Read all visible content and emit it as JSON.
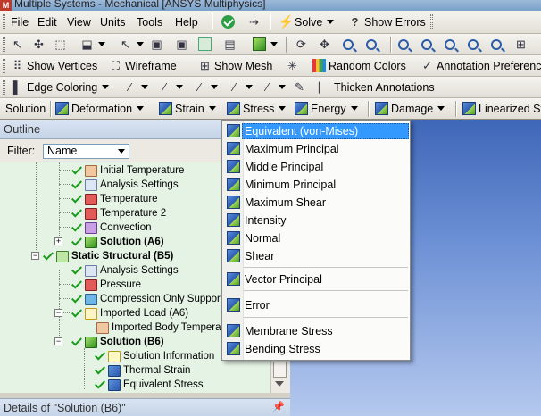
{
  "window": {
    "title": "Multiple Systems - Mechanical [ANSYS Multiphysics]",
    "app_icon_letter": "M"
  },
  "menubar": {
    "items": [
      "File",
      "Edit",
      "View",
      "Units",
      "Tools",
      "Help"
    ],
    "solve_label": "Solve",
    "show_errors_label": "Show Errors"
  },
  "toolbar3": {
    "show_vertices": "Show Vertices",
    "wireframe": "Wireframe",
    "show_mesh": "Show Mesh",
    "random_colors": "Random Colors",
    "annotation_prefs": "Annotation Preferences"
  },
  "toolbar4": {
    "edge_coloring": "Edge Coloring",
    "thicken_annotations": "Thicken Annotations"
  },
  "context_toolbar": {
    "solution": "Solution",
    "deformation": "Deformation",
    "strain": "Strain",
    "stress": "Stress",
    "energy": "Energy",
    "damage": "Damage",
    "linearized": "Linearized Stress"
  },
  "outline": {
    "header": "Outline",
    "filter_label": "Filter:",
    "filter_value": "Name",
    "nodes": [
      {
        "label": "Initial Temperature",
        "bold": false
      },
      {
        "label": "Analysis Settings",
        "bold": false
      },
      {
        "label": "Temperature",
        "bold": false
      },
      {
        "label": "Temperature 2",
        "bold": false
      },
      {
        "label": "Convection",
        "bold": false
      },
      {
        "label": "Solution (A6)",
        "bold": true
      },
      {
        "label": "Static Structural (B5)",
        "bold": true
      },
      {
        "label": "Analysis Settings",
        "bold": false
      },
      {
        "label": "Pressure",
        "bold": false
      },
      {
        "label": "Compression Only Support",
        "bold": false
      },
      {
        "label": "Imported Load (A6)",
        "bold": false
      },
      {
        "label": "Imported Body Temperature",
        "bold": false
      },
      {
        "label": "Solution (B6)",
        "bold": true
      },
      {
        "label": "Solution Information",
        "bold": false
      },
      {
        "label": "Thermal Strain",
        "bold": false
      },
      {
        "label": "Equivalent Stress",
        "bold": false
      }
    ],
    "expand_plus": "+",
    "expand_minus": "−"
  },
  "details": {
    "header": "Details of \"Solution (B6)\"",
    "pin": "📌"
  },
  "stress_menu": {
    "items": [
      "Equivalent (von-Mises)",
      "Maximum Principal",
      "Middle Principal",
      "Minimum Principal",
      "Maximum Shear",
      "Intensity",
      "Normal",
      "Shear",
      "Vector Principal",
      "Error",
      "Membrane Stress",
      "Bending Stress"
    ],
    "highlighted_index": 0
  },
  "colors": {
    "highlight": "#3399ff",
    "tree_bg": "#e4f3e4",
    "check_green": "#1a9a1a",
    "viewport_top": "#3f67b8"
  }
}
